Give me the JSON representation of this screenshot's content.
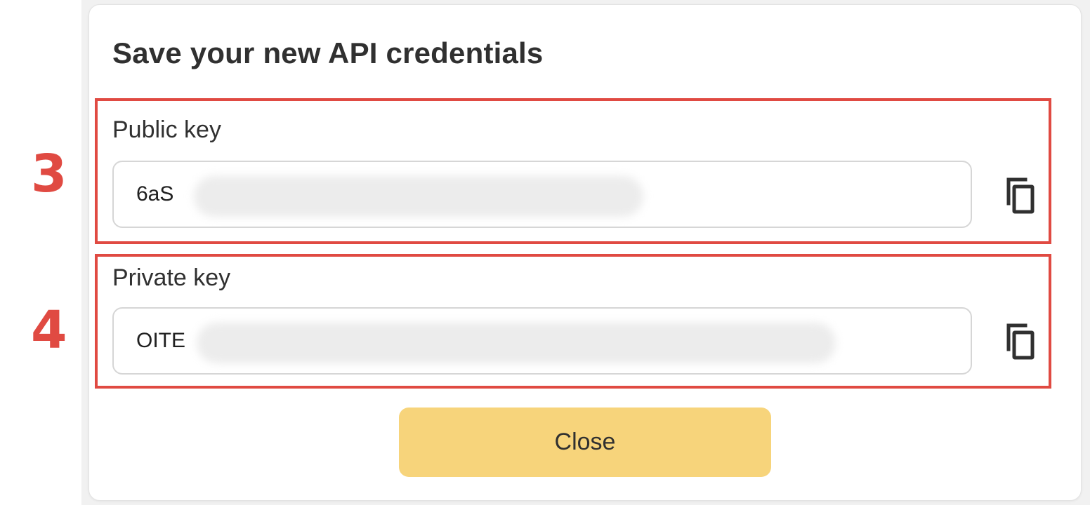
{
  "dialog": {
    "title": "Save your new API credentials",
    "close_label": "Close"
  },
  "annotations": {
    "step_public": "3",
    "step_private": "4",
    "highlight_color": "#e04a42"
  },
  "public_key": {
    "label": "Public key",
    "visible_value": "6aS",
    "obscured": true,
    "copy_icon": "copy-icon"
  },
  "private_key": {
    "label": "Private key",
    "visible_value": "OITE",
    "obscured": true,
    "copy_icon": "copy-icon"
  },
  "colors": {
    "button_bg": "#f7d47b",
    "text": "#303030",
    "input_border": "#d6d6d6"
  }
}
